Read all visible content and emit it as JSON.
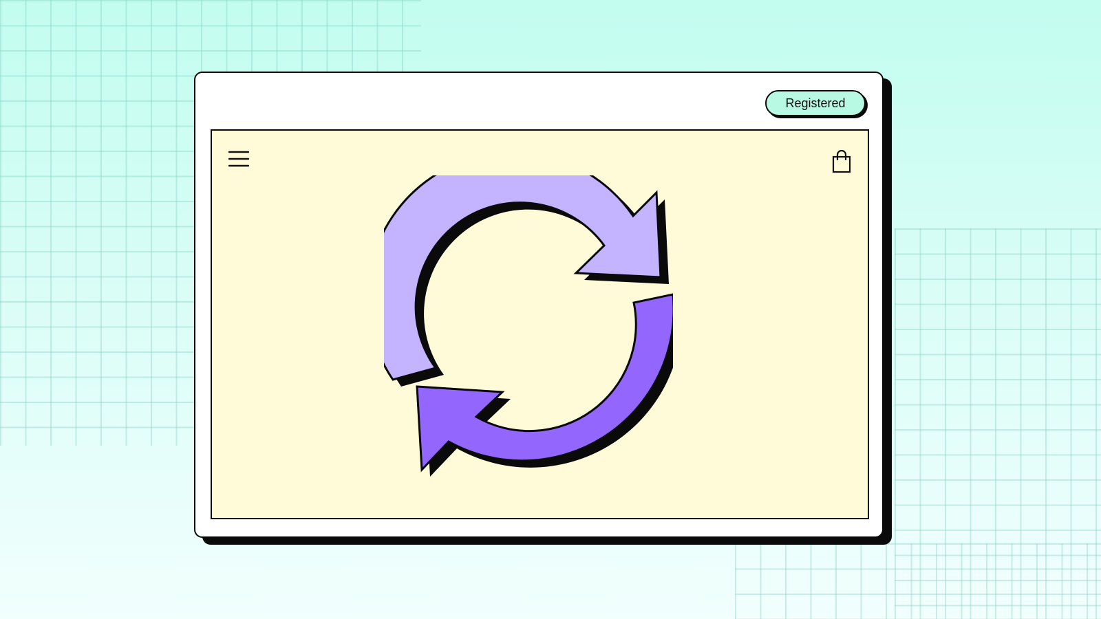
{
  "window": {
    "status_badge": "Registered"
  },
  "icons": {
    "menu": "hamburger-menu-icon",
    "cart": "shopping-bag-icon",
    "hero": "refresh-arrows-icon"
  },
  "colors": {
    "background": "#c2fdf0",
    "badge": "#b7f9e3",
    "content_background": "#fffbd9",
    "arrow_light": "#c4b3ff",
    "arrow_dark": "#9366fd",
    "outline": "#0a0a0a"
  }
}
